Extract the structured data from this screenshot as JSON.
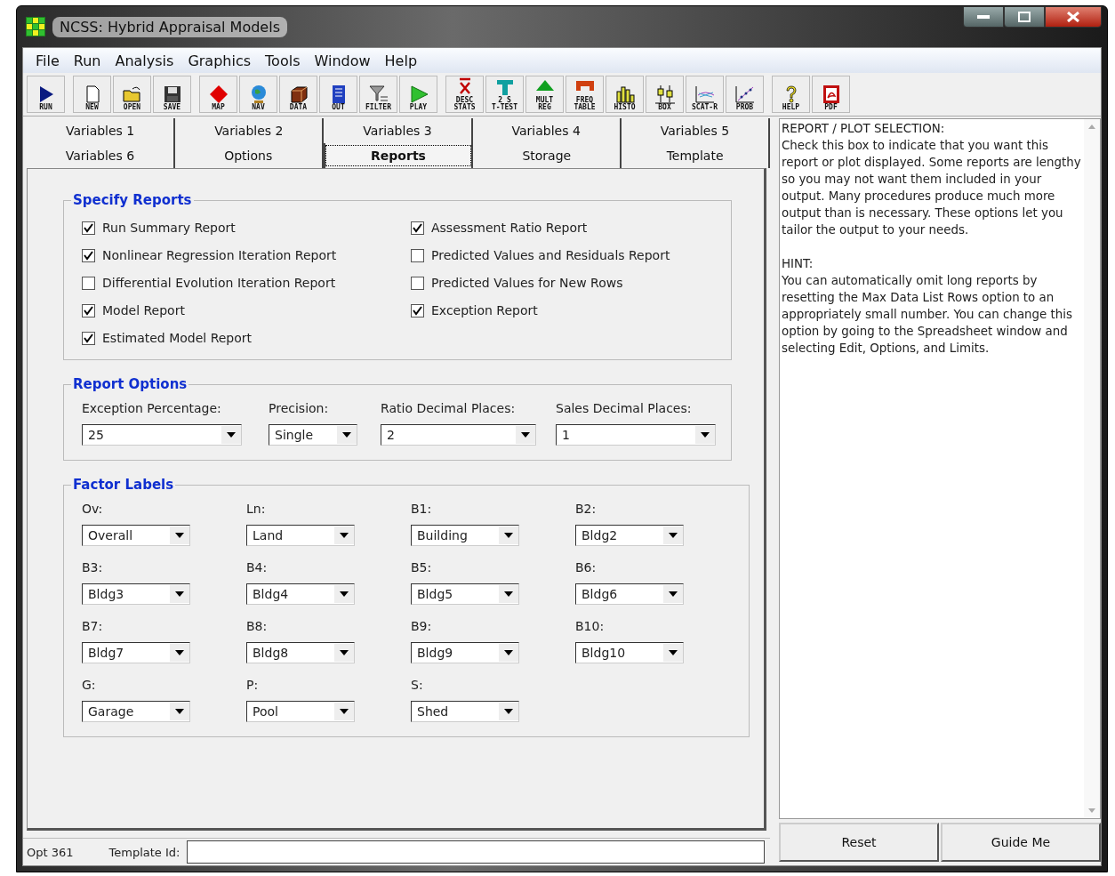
{
  "window": {
    "title": "NCSS: Hybrid Appraisal Models"
  },
  "menu": [
    "File",
    "Run",
    "Analysis",
    "Graphics",
    "Tools",
    "Window",
    "Help"
  ],
  "toolbar_groups": [
    [
      {
        "kind": "run",
        "lines": [
          "RUN"
        ]
      }
    ],
    [
      {
        "kind": "new",
        "lines": [
          "NEW"
        ]
      },
      {
        "kind": "open",
        "lines": [
          "OPEN"
        ]
      },
      {
        "kind": "save",
        "lines": [
          "SAVE"
        ]
      }
    ],
    [
      {
        "kind": "map",
        "lines": [
          "MAP"
        ]
      },
      {
        "kind": "nav",
        "lines": [
          "NAV"
        ]
      },
      {
        "kind": "data",
        "lines": [
          "DATA"
        ]
      },
      {
        "kind": "out",
        "lines": [
          "OUT"
        ]
      },
      {
        "kind": "filter",
        "lines": [
          "FILTER"
        ]
      },
      {
        "kind": "play",
        "lines": [
          "PLAY"
        ]
      }
    ],
    [
      {
        "kind": "desc",
        "lines": [
          "DESC",
          "STATS"
        ]
      },
      {
        "kind": "ttest",
        "lines": [
          "2 S",
          "T-TEST"
        ]
      },
      {
        "kind": "mult",
        "lines": [
          "MULT",
          "REG"
        ]
      },
      {
        "kind": "freq",
        "lines": [
          "FREQ",
          "TABLE"
        ]
      },
      {
        "kind": "histo",
        "lines": [
          "HISTO"
        ]
      },
      {
        "kind": "box",
        "lines": [
          "BOX"
        ]
      },
      {
        "kind": "scatter",
        "lines": [
          "SCAT-R"
        ]
      },
      {
        "kind": "prob",
        "lines": [
          "PROB"
        ]
      }
    ],
    [
      {
        "kind": "help",
        "lines": [
          "HELP"
        ]
      },
      {
        "kind": "pdf",
        "lines": [
          "PDF"
        ]
      }
    ]
  ],
  "tab_rows": [
    [
      {
        "label": "Variables 1",
        "selected": false
      },
      {
        "label": "Variables 2",
        "selected": false
      },
      {
        "label": "Variables 3",
        "selected": false
      },
      {
        "label": "Variables 4",
        "selected": false
      },
      {
        "label": "Variables 5",
        "selected": false
      }
    ],
    [
      {
        "label": "Variables 6",
        "selected": false
      },
      {
        "label": "Options",
        "selected": false
      },
      {
        "label": "Reports",
        "selected": true
      },
      {
        "label": "Storage",
        "selected": false
      },
      {
        "label": "Template",
        "selected": false
      }
    ]
  ],
  "specify_reports": {
    "title": "Specify Reports",
    "columns": [
      [
        {
          "label": "Run Summary Report",
          "checked": true
        },
        {
          "label": "Nonlinear Regression Iteration Report",
          "checked": true
        },
        {
          "label": "Differential Evolution Iteration Report",
          "checked": false
        },
        {
          "label": "Model Report",
          "checked": true
        },
        {
          "label": "Estimated Model Report",
          "checked": true
        }
      ],
      [
        {
          "label": "Assessment Ratio Report",
          "checked": true
        },
        {
          "label": "Predicted Values and Residuals Report",
          "checked": false
        },
        {
          "label": "Predicted Values for New Rows",
          "checked": false
        },
        {
          "label": "Exception Report",
          "checked": true
        }
      ]
    ]
  },
  "report_options": {
    "title": "Report Options",
    "fields": [
      {
        "label": "Exception Percentage:",
        "value": "25"
      },
      {
        "label": "Precision:",
        "value": "Single"
      },
      {
        "label": "Ratio Decimal Places:",
        "value": "2"
      },
      {
        "label": "Sales Decimal Places:",
        "value": "1"
      }
    ]
  },
  "factor_labels": {
    "title": "Factor Labels",
    "fields": [
      {
        "label": "Ov:",
        "value": "Overall"
      },
      {
        "label": "Ln:",
        "value": "Land"
      },
      {
        "label": "B1:",
        "value": "Building"
      },
      {
        "label": "B2:",
        "value": "Bldg2"
      },
      {
        "label": "B3:",
        "value": "Bldg3"
      },
      {
        "label": "B4:",
        "value": "Bldg4"
      },
      {
        "label": "B5:",
        "value": "Bldg5"
      },
      {
        "label": "B6:",
        "value": "Bldg6"
      },
      {
        "label": "B7:",
        "value": "Bldg7"
      },
      {
        "label": "B8:",
        "value": "Bldg8"
      },
      {
        "label": "B9:",
        "value": "Bldg9"
      },
      {
        "label": "B10:",
        "value": "Bldg10"
      },
      {
        "label": "G:",
        "value": "Garage"
      },
      {
        "label": "P:",
        "value": "Pool"
      },
      {
        "label": "S:",
        "value": "Shed"
      }
    ]
  },
  "help": {
    "paragraphs": [
      "REPORT / PLOT SELECTION:",
      "Check this box to indicate that you want this report or plot displayed. Some reports are lengthy so you may not want them included in your output. Many procedures produce much more output than is necessary. These options let you tailor the output to your needs.",
      "HINT:",
      "You can automatically omit long reports by resetting the Max Data List Rows option to an appropriately small number. You can change this option by going to the Spreadsheet window and selecting Edit, Options, and Limits."
    ]
  },
  "buttons": [
    "Reset",
    "Guide Me"
  ],
  "status_bar": {
    "option": "Opt 361",
    "template_label": "Template Id:"
  }
}
